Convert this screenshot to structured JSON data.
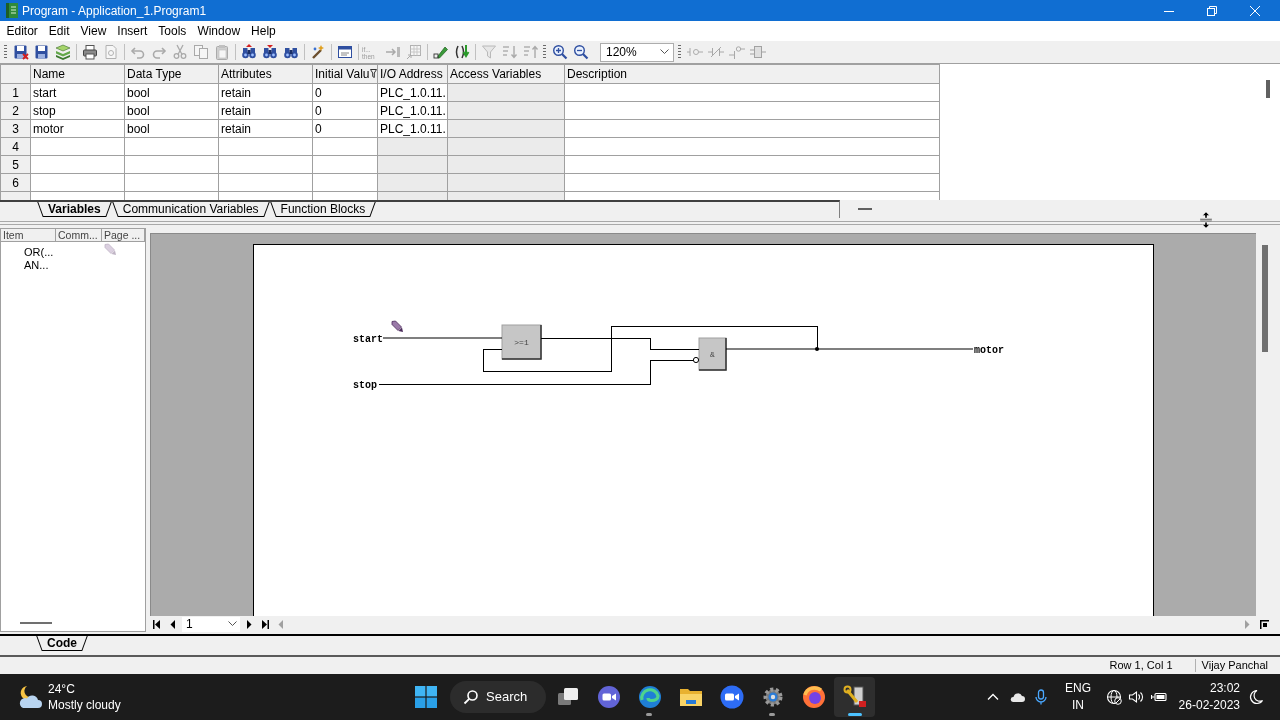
{
  "window": {
    "title": "Program - Application_1.Program1"
  },
  "menu": [
    "Editor",
    "Edit",
    "View",
    "Insert",
    "Tools",
    "Window",
    "Help"
  ],
  "toolbar": {
    "items": [
      {
        "kind": "grip"
      },
      {
        "kind": "save-close",
        "disabled": false
      },
      {
        "kind": "save",
        "disabled": false
      },
      {
        "kind": "stack",
        "disabled": false
      },
      {
        "kind": "separator"
      },
      {
        "kind": "print",
        "disabled": false
      },
      {
        "kind": "preview",
        "disabled": true
      },
      {
        "kind": "separator"
      },
      {
        "kind": "undo",
        "disabled": true
      },
      {
        "kind": "redo",
        "disabled": true
      },
      {
        "kind": "cut",
        "disabled": true
      },
      {
        "kind": "copy",
        "disabled": true
      },
      {
        "kind": "paste",
        "disabled": true
      },
      {
        "kind": "separator"
      },
      {
        "kind": "find-prev",
        "disabled": false
      },
      {
        "kind": "find-next",
        "disabled": false
      },
      {
        "kind": "find",
        "disabled": false
      },
      {
        "kind": "separator"
      },
      {
        "kind": "wand",
        "disabled": false
      },
      {
        "kind": "separator"
      },
      {
        "kind": "window",
        "disabled": false
      },
      {
        "kind": "separator"
      },
      {
        "kind": "text-tool",
        "label": "if... then",
        "disabled": true
      },
      {
        "kind": "arrow",
        "disabled": true
      },
      {
        "kind": "grid",
        "disabled": true
      },
      {
        "kind": "separator"
      },
      {
        "kind": "pen",
        "disabled": false
      },
      {
        "kind": "function",
        "disabled": false
      },
      {
        "kind": "separator"
      },
      {
        "kind": "filter",
        "disabled": true
      },
      {
        "kind": "sort-down",
        "disabled": true
      },
      {
        "kind": "sort-up",
        "disabled": true
      },
      {
        "kind": "grip"
      },
      {
        "kind": "zoom-in",
        "disabled": false
      },
      {
        "kind": "zoom-out",
        "disabled": false
      },
      {
        "kind": "zoom-select",
        "value": "120%"
      },
      {
        "kind": "grip"
      },
      {
        "kind": "contact",
        "disabled": true
      },
      {
        "kind": "crossed",
        "disabled": true
      },
      {
        "kind": "coil",
        "disabled": true
      },
      {
        "kind": "block",
        "disabled": true
      }
    ]
  },
  "variables": {
    "columns": [
      {
        "label": "Name"
      },
      {
        "label": "Data Type"
      },
      {
        "label": "Attributes"
      },
      {
        "label": "Initial Valu",
        "filter": true
      },
      {
        "label": "I/O Address",
        "shade_empty": true
      },
      {
        "label": "Access Variables",
        "shaded": true
      },
      {
        "label": "Description"
      }
    ],
    "rows": [
      {
        "number": "1",
        "name": "start",
        "data_type": "bool",
        "attributes": "retain",
        "initial_value": "0",
        "io_address": "PLC_1.0.11."
      },
      {
        "number": "2",
        "name": "stop",
        "data_type": "bool",
        "attributes": "retain",
        "initial_value": "0",
        "io_address": "PLC_1.0.11."
      },
      {
        "number": "3",
        "name": "motor",
        "data_type": "bool",
        "attributes": "retain",
        "initial_value": "0",
        "io_address": "PLC_1.0.11."
      },
      {
        "number": "4"
      },
      {
        "number": "5"
      },
      {
        "number": "6"
      }
    ]
  },
  "sheet_tabs": [
    {
      "label": "Variables",
      "selected": true
    },
    {
      "label": "Communication Variables",
      "selected": false
    },
    {
      "label": "Function Blocks",
      "selected": false
    }
  ],
  "block_list": {
    "columns": [
      "Item",
      "Comm...",
      "Page ..."
    ],
    "items": [
      "OR(...",
      "AN..."
    ]
  },
  "diagram": {
    "inputs": [
      {
        "label": "start",
        "negated": false
      },
      {
        "label": "stop",
        "negated": true
      }
    ],
    "blocks": [
      {
        "kind": "or",
        "label": ">=1"
      },
      {
        "kind": "and",
        "label": "&"
      }
    ],
    "outputs": [
      {
        "label": "motor"
      }
    ]
  },
  "page_nav": {
    "page": "1"
  },
  "code_tabs": [
    {
      "label": "Code",
      "selected": true
    }
  ],
  "status_bar": [
    "Row 1, Col 1",
    "Vijay Panchal"
  ],
  "taskbar": {
    "weather": {
      "temperature": "24°C",
      "condition": "Mostly cloudy"
    },
    "search": {
      "label": "Search"
    },
    "apps": [
      {
        "kind": "task-view",
        "running": false,
        "selected": false
      },
      {
        "kind": "video-chat",
        "running": false,
        "selected": false
      },
      {
        "kind": "edge",
        "running": true,
        "selected": false
      },
      {
        "kind": "files",
        "running": false,
        "selected": false
      },
      {
        "kind": "zoom",
        "running": false,
        "selected": false
      },
      {
        "kind": "settings",
        "running": true,
        "selected": false
      },
      {
        "kind": "firefox",
        "running": false,
        "selected": false
      },
      {
        "kind": "plc",
        "running": true,
        "selected": true
      }
    ],
    "tray": {
      "language": "ENG",
      "region": "IN",
      "time": "23:02",
      "date": "26-02-2023"
    }
  }
}
